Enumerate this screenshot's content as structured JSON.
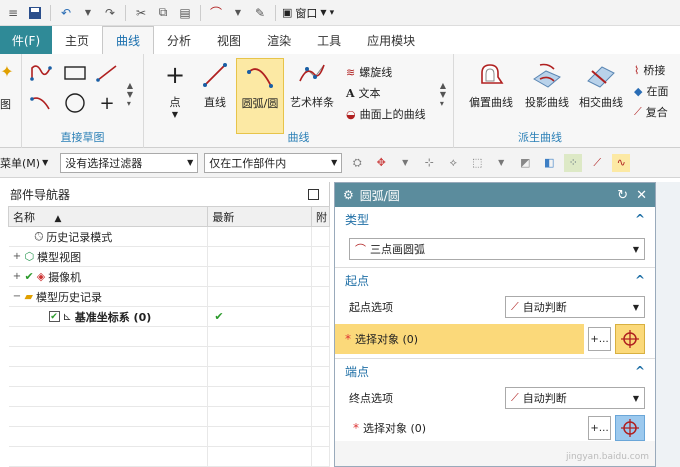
{
  "qat": {
    "window_label": "窗口"
  },
  "tabs": {
    "file": "件(F)",
    "items": [
      "主页",
      "曲线",
      "分析",
      "视图",
      "渲染",
      "工具",
      "应用模块"
    ],
    "active": 1
  },
  "ribbon": {
    "left_partial_label": "图",
    "direct_sketch_label": "直接草图",
    "curve_group_label": "曲线",
    "derived_group_label": "派生曲线",
    "buttons": {
      "point": "点",
      "line": "直线",
      "arc": "圆弧/圆",
      "spline": "艺术样条",
      "helix": "螺旋线",
      "text": "文本",
      "curve_on_surface": "曲面上的曲线",
      "offset": "偏置曲线",
      "project": "投影曲线",
      "intersect": "相交曲线",
      "bridge": "桥接",
      "on_face": "在面",
      "composite": "复合"
    }
  },
  "filterbar": {
    "menu": "菜单(M)",
    "filter": "没有选择过滤器",
    "scope": "仅在工作部件内"
  },
  "navigator": {
    "title": "部件导航器",
    "columns": [
      "名称",
      "最新",
      "附"
    ],
    "rows": [
      {
        "label": "历史记录模式",
        "latest": ""
      },
      {
        "label": "模型视图",
        "latest": ""
      },
      {
        "label": "摄像机",
        "latest": ""
      },
      {
        "label": "模型历史记录",
        "latest": ""
      },
      {
        "label": "基准坐标系 (0)",
        "latest": "✔"
      }
    ]
  },
  "dialog": {
    "title": "圆弧/圆",
    "type_section": "类型",
    "type_value": "三点画圆弧",
    "start_section": "起点",
    "start_option_label": "起点选项",
    "start_option_value": "自动判断",
    "select_object": "选择对象 (0)",
    "end_section": "端点",
    "end_option_label": "终点选项",
    "end_option_value": "自动判断",
    "end_select_object": "选择对象 (0)"
  },
  "watermark": "jingyan.baidu.com",
  "colors": {
    "file_tab": "#2f8a97",
    "dialog_header": "#5b8c9d",
    "highlight": "#fbd97a",
    "accent": "#1f6fa6"
  }
}
